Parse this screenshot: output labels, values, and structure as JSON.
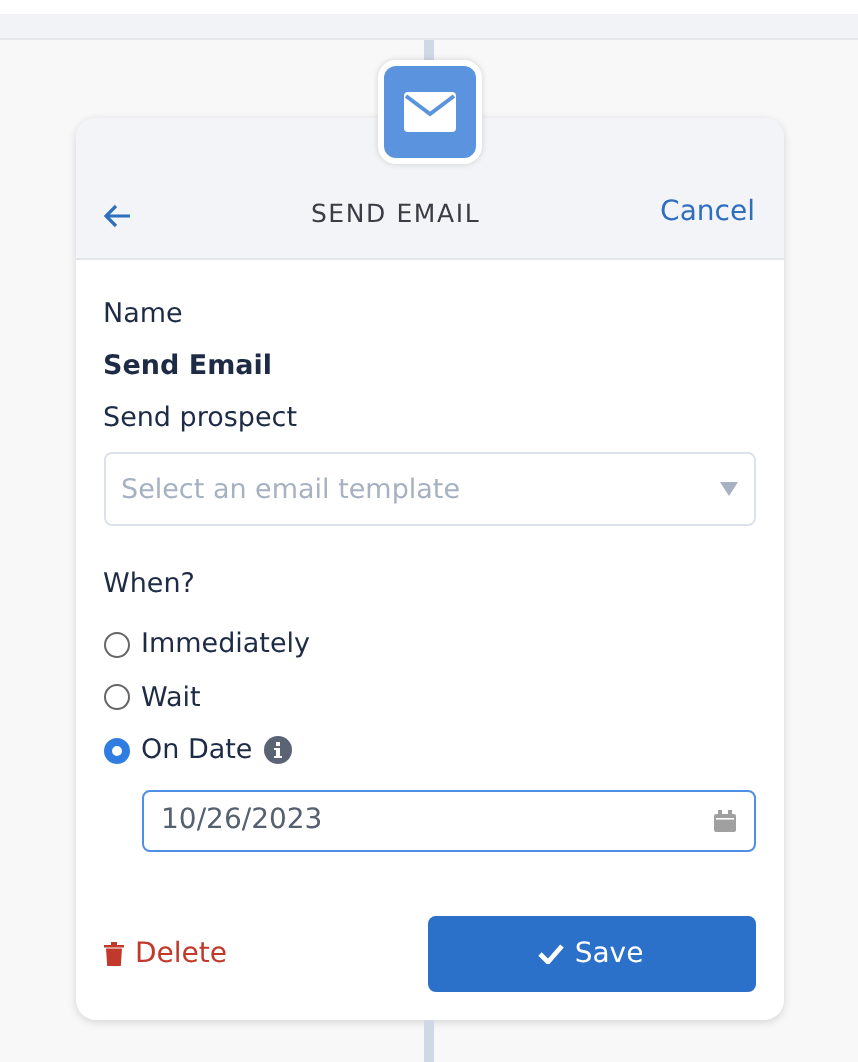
{
  "header": {
    "title": "SEND EMAIL",
    "cancel": "Cancel"
  },
  "name": {
    "label": "Name",
    "value": "Send Email"
  },
  "template": {
    "label": "Send prospect",
    "placeholder": "Select an email template"
  },
  "when": {
    "label": "When?",
    "options": [
      {
        "label": "Immediately",
        "selected": false
      },
      {
        "label": "Wait",
        "selected": false
      },
      {
        "label": "On Date",
        "selected": true,
        "info": true
      }
    ]
  },
  "date": {
    "value": "10/26/2023"
  },
  "footer": {
    "delete": "Delete",
    "save": "Save"
  }
}
